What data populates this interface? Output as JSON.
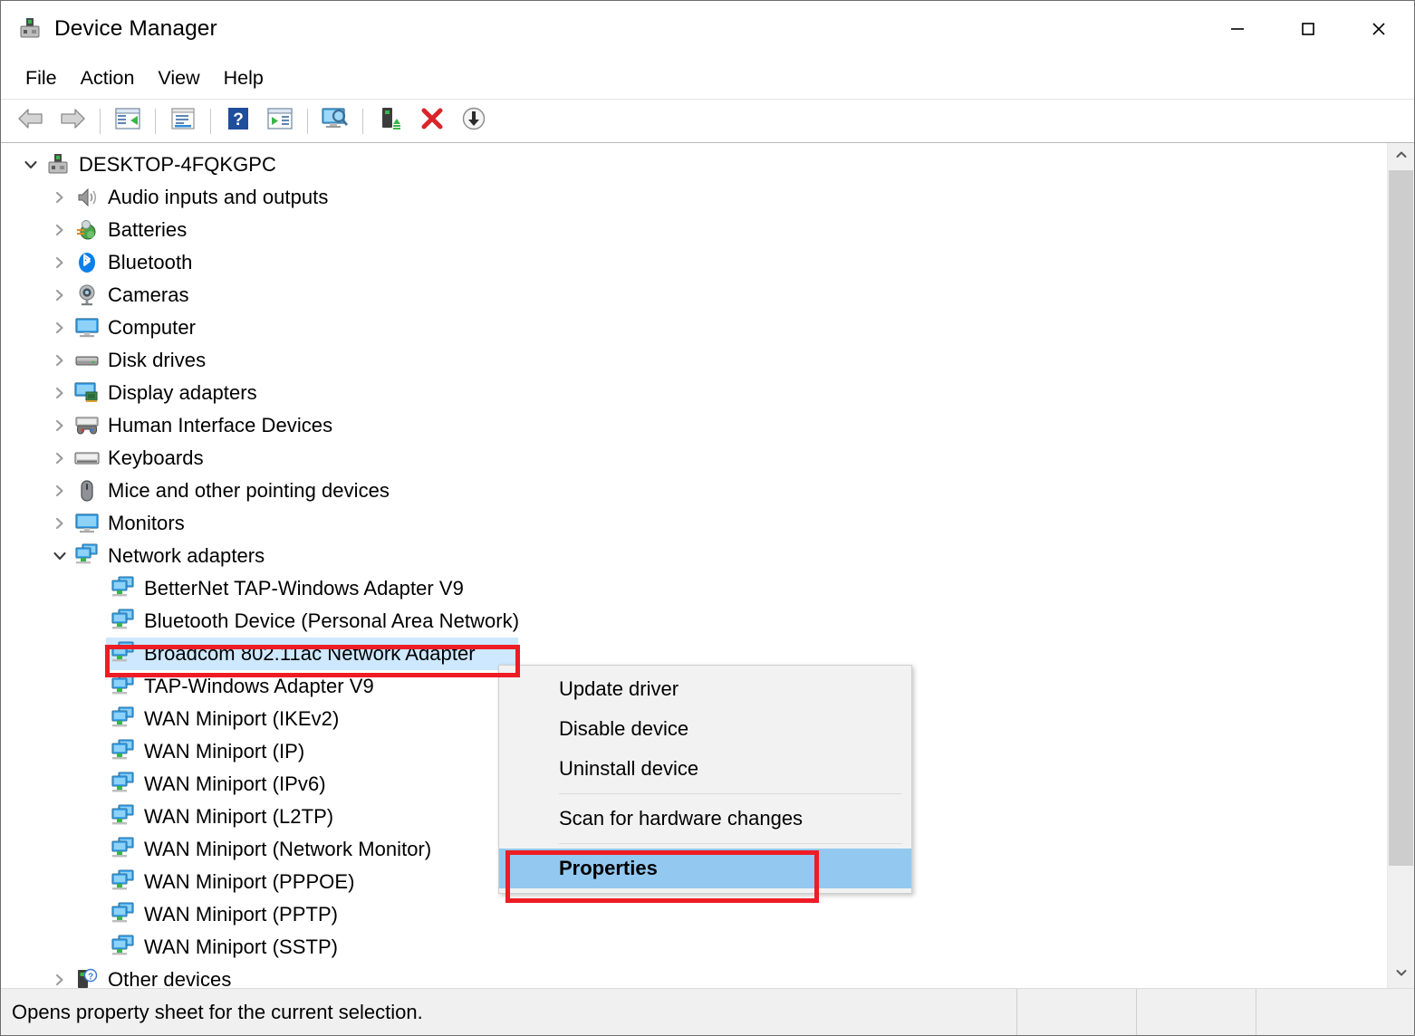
{
  "window": {
    "title": "Device Manager",
    "app_icon": "device-manager-icon",
    "caption": {
      "minimize": "minimize-icon",
      "maximize": "maximize-icon",
      "close": "close-icon"
    }
  },
  "menubar": {
    "items": [
      {
        "label": "File"
      },
      {
        "label": "Action"
      },
      {
        "label": "View"
      },
      {
        "label": "Help"
      }
    ]
  },
  "toolbar": {
    "buttons": [
      {
        "name": "back-button",
        "icon": "back-arrow-icon"
      },
      {
        "name": "forward-button",
        "icon": "forward-arrow-icon"
      },
      {
        "name": "show-hide-console-tree-button",
        "icon": "console-tree-icon"
      },
      {
        "name": "properties-button",
        "icon": "properties-page-icon"
      },
      {
        "name": "help-button",
        "icon": "question-mark-icon"
      },
      {
        "name": "update-driver-button",
        "icon": "play-list-icon"
      },
      {
        "name": "scan-for-hardware-changes-button",
        "icon": "monitor-magnifier-icon"
      },
      {
        "name": "update-device-driver-button",
        "icon": "device-upgrade-icon"
      },
      {
        "name": "uninstall-device-button",
        "icon": "red-x-icon"
      },
      {
        "name": "disable-device-button",
        "icon": "down-arrow-circle-icon"
      }
    ]
  },
  "tree": {
    "root": {
      "label": "DESKTOP-4FQKGPC",
      "icon": "computer-root-icon",
      "expanded": true
    },
    "categories": [
      {
        "label": "Audio inputs and outputs",
        "icon": "speaker-icon",
        "expanded": false
      },
      {
        "label": "Batteries",
        "icon": "battery-icon",
        "expanded": false
      },
      {
        "label": "Bluetooth",
        "icon": "bluetooth-icon",
        "expanded": false
      },
      {
        "label": "Cameras",
        "icon": "camera-icon",
        "expanded": false
      },
      {
        "label": "Computer",
        "icon": "monitor-icon",
        "expanded": false
      },
      {
        "label": "Disk drives",
        "icon": "disk-drive-icon",
        "expanded": false
      },
      {
        "label": "Display adapters",
        "icon": "display-adapter-icon",
        "expanded": false
      },
      {
        "label": "Human Interface Devices",
        "icon": "hid-icon",
        "expanded": false
      },
      {
        "label": "Keyboards",
        "icon": "keyboard-icon",
        "expanded": false
      },
      {
        "label": "Mice and other pointing devices",
        "icon": "mouse-icon",
        "expanded": false
      },
      {
        "label": "Monitors",
        "icon": "monitor-icon",
        "expanded": false
      },
      {
        "label": "Network adapters",
        "icon": "network-adapter-icon",
        "expanded": true
      }
    ],
    "network_devices": [
      {
        "label": "BetterNet TAP-Windows Adapter V9",
        "icon": "network-adapter-icon",
        "selected": false
      },
      {
        "label": "Bluetooth Device (Personal Area Network)",
        "icon": "network-adapter-icon",
        "selected": false
      },
      {
        "label": "Broadcom 802.11ac Network Adapter",
        "icon": "network-adapter-icon",
        "selected": true
      },
      {
        "label": "TAP-Windows Adapter V9",
        "icon": "network-adapter-icon",
        "selected": false
      },
      {
        "label": "WAN Miniport (IKEv2)",
        "icon": "network-adapter-icon",
        "selected": false
      },
      {
        "label": "WAN Miniport (IP)",
        "icon": "network-adapter-icon",
        "selected": false
      },
      {
        "label": "WAN Miniport (IPv6)",
        "icon": "network-adapter-icon",
        "selected": false
      },
      {
        "label": "WAN Miniport (L2TP)",
        "icon": "network-adapter-icon",
        "selected": false
      },
      {
        "label": "WAN Miniport (Network Monitor)",
        "icon": "network-adapter-icon",
        "selected": false
      },
      {
        "label": "WAN Miniport (PPPOE)",
        "icon": "network-adapter-icon",
        "selected": false
      },
      {
        "label": "WAN Miniport (PPTP)",
        "icon": "network-adapter-icon",
        "selected": false
      },
      {
        "label": "WAN Miniport (SSTP)",
        "icon": "network-adapter-icon",
        "selected": false
      }
    ],
    "trailing": [
      {
        "label": "Other devices",
        "icon": "unknown-device-icon",
        "expanded": false
      }
    ]
  },
  "context_menu": {
    "items": [
      {
        "label": "Update driver",
        "highlighted": false,
        "separator_after": false
      },
      {
        "label": "Disable device",
        "highlighted": false,
        "separator_after": false
      },
      {
        "label": "Uninstall device",
        "highlighted": false,
        "separator_after": true
      },
      {
        "label": "Scan for hardware changes",
        "highlighted": false,
        "separator_after": true
      },
      {
        "label": "Properties",
        "highlighted": true,
        "separator_after": false
      }
    ]
  },
  "statusbar": {
    "message": "Opens property sheet for the current selection."
  },
  "annotations": {
    "accent_color": "#ee1c25",
    "boxes": [
      {
        "name": "broadcom-device-annotation",
        "target": "Broadcom 802.11ac Network Adapter"
      },
      {
        "name": "properties-menu-annotation",
        "target": "Properties"
      }
    ]
  },
  "colors": {
    "selection_blue": "#cde8ff",
    "menu_highlight_blue": "#93c9f0",
    "window_bg": "#ffffff",
    "statusbar_bg": "#f0f0f0",
    "annotation_red": "#ee1c25"
  },
  "scrollbar": {
    "up_arrow": "chevron-up-icon",
    "down_arrow": "chevron-down-icon"
  }
}
